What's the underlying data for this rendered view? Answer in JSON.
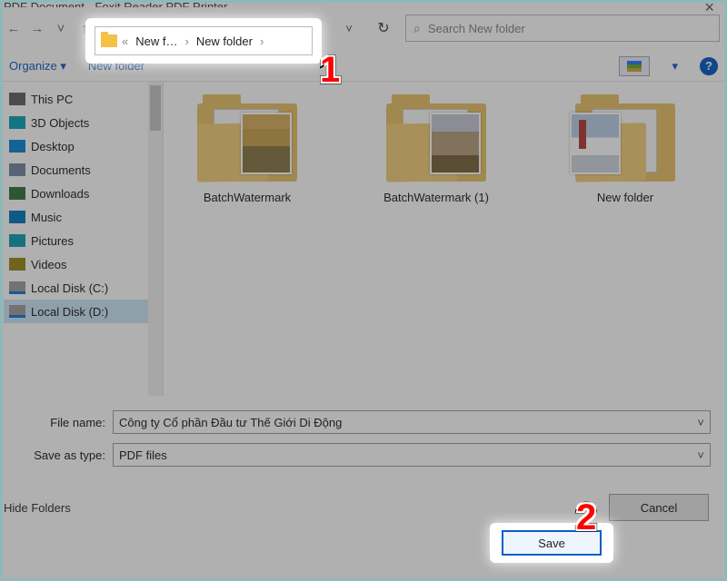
{
  "window": {
    "title": "PDF Document - Foxit Reader PDF Printer",
    "close": "×"
  },
  "nav": {
    "back": "←",
    "fwd": "→",
    "drop": "˅",
    "up": "↑",
    "breadcrumb": {
      "overflow": "«",
      "seg1": "New f…",
      "seg2": "New folder",
      "sep": "›"
    },
    "path_drop": "˅",
    "refresh": "↻",
    "search_placeholder": "Search New folder"
  },
  "toolbar": {
    "organize": "Organize ▾",
    "newfolder": "New folder",
    "view_drop": "▾",
    "help": "?"
  },
  "tree": {
    "items": [
      {
        "label": "This PC",
        "iconcls": "ico-pc"
      },
      {
        "label": "3D Objects",
        "iconcls": "ico-3d"
      },
      {
        "label": "Desktop",
        "iconcls": "ico-desktop"
      },
      {
        "label": "Documents",
        "iconcls": "ico-docs"
      },
      {
        "label": "Downloads",
        "iconcls": "ico-downloads"
      },
      {
        "label": "Music",
        "iconcls": "ico-music"
      },
      {
        "label": "Pictures",
        "iconcls": "ico-pictures"
      },
      {
        "label": "Videos",
        "iconcls": "ico-videos"
      },
      {
        "label": "Local Disk (C:)",
        "iconcls": "ico-disk"
      },
      {
        "label": "Local Disk (D:)",
        "iconcls": "ico-disk"
      }
    ]
  },
  "files": {
    "items": [
      {
        "name": "BatchWatermark"
      },
      {
        "name": "BatchWatermark (1)"
      },
      {
        "name": "New folder"
      }
    ]
  },
  "form": {
    "file_label": "File name:",
    "file_value": "Công ty Cổ phần Đầu tư Thế Giới Di Động",
    "type_label": "Save as type:",
    "type_value": "PDF files"
  },
  "footer": {
    "hide_folders": "Hide Folders",
    "save": "Save",
    "cancel": "Cancel"
  },
  "callouts": {
    "c1": "1",
    "c2": "2"
  }
}
